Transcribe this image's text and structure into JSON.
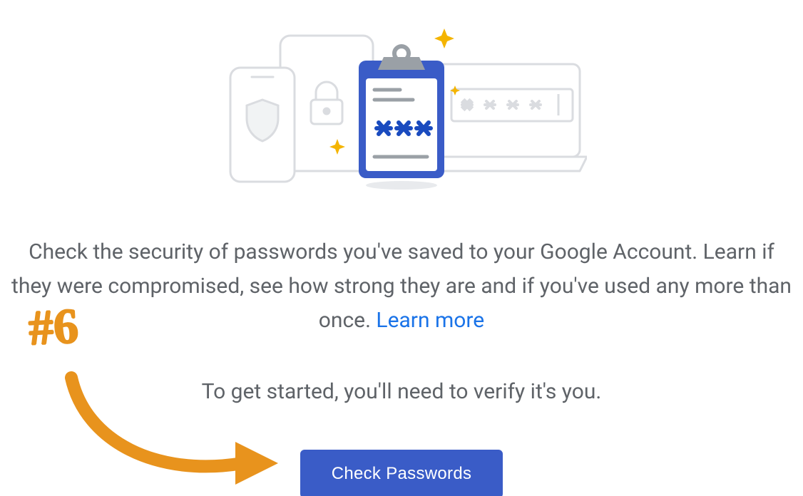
{
  "description": {
    "text": "Check the security of passwords you've saved to your Google Account. Learn if they were compromised, see how strong they are and if you've used any more than once. ",
    "learn_more_label": "Learn more"
  },
  "subtext": "To get started, you'll need to verify it's you.",
  "cta": {
    "label": "Check Passwords"
  },
  "annotation": {
    "number": "#6"
  },
  "colors": {
    "accent": "#3a5cc7",
    "link": "#1a73e8",
    "annotation": "#e8931d",
    "illustration_outline": "#dadce0",
    "sparkle": "#f4b400"
  }
}
